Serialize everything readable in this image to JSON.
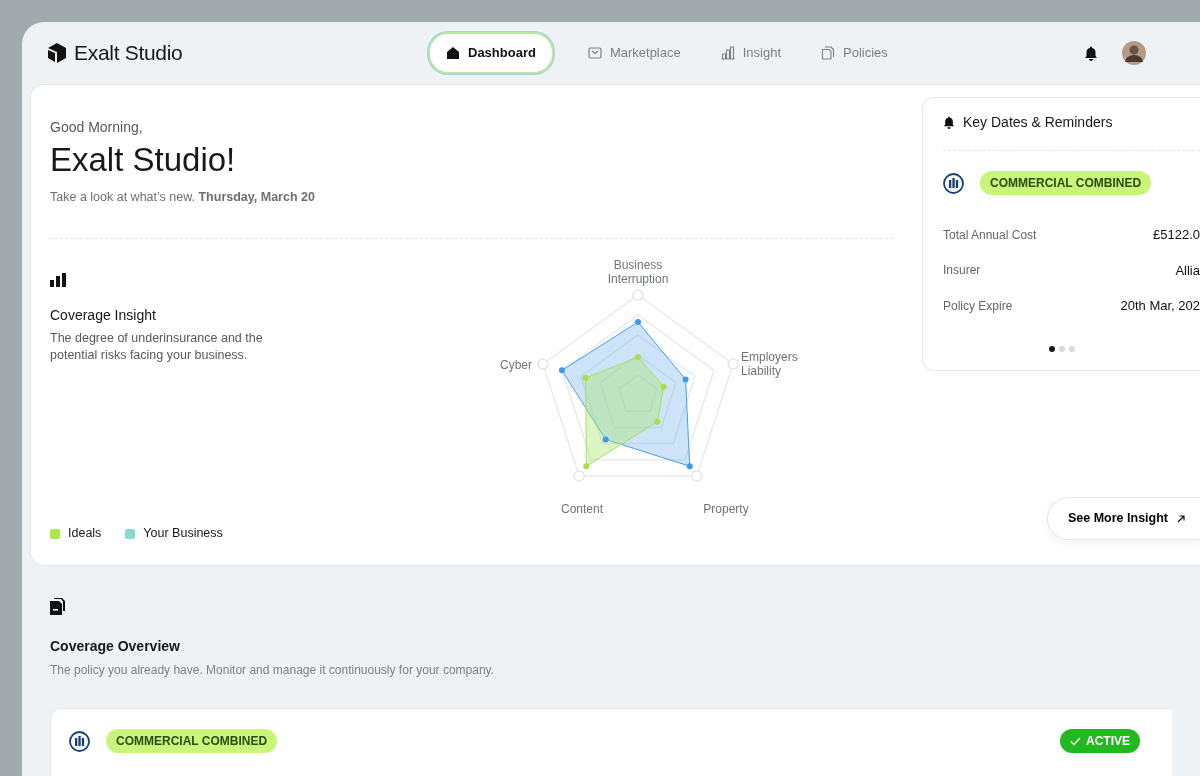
{
  "brand": "Exalt Studio",
  "nav": [
    {
      "label": "Dashboard",
      "selected": true
    },
    {
      "label": "Marketplace",
      "selected": false
    },
    {
      "label": "Insight",
      "selected": false
    },
    {
      "label": "Policies",
      "selected": false
    }
  ],
  "greeting": "Good Morning,",
  "company": "Exalt Studio!",
  "subtitle": "Take a look at what’s new. **Thursday, March 20**",
  "insight": {
    "title": "Coverage Insight",
    "description": "The degree of underinsurance and the potential risks facing your business.",
    "axes": [
      "Business Interruption",
      "Employers Liability",
      "Property",
      "Content",
      "Cyber"
    ],
    "legend": [
      {
        "label": "Ideals",
        "color": "#a8e847"
      },
      {
        "label": "Your Business",
        "color": "#86dccf"
      }
    ]
  },
  "reminders": {
    "title": "Key Dates & Reminders",
    "badge": "COMMERCIAL COMBINED",
    "rows": [
      {
        "label": "Total Annual Cost",
        "value": "£5122.0"
      },
      {
        "label": "Insurer",
        "value": "Allia"
      },
      {
        "label": "Policy Expire",
        "value": "20th Mar, 202"
      }
    ],
    "pages": [
      {
        "selected": true
      },
      {
        "selected": false
      },
      {
        "selected": false
      }
    ]
  },
  "see_more": "See More Insight",
  "overview": {
    "title": "Coverage Overview",
    "description": "The policy you already have. Monitor and manage it continuously for your company.",
    "policy": {
      "badge": "COMMERCIAL COMBINED",
      "status": "ACTIVE",
      "active": true
    }
  }
}
